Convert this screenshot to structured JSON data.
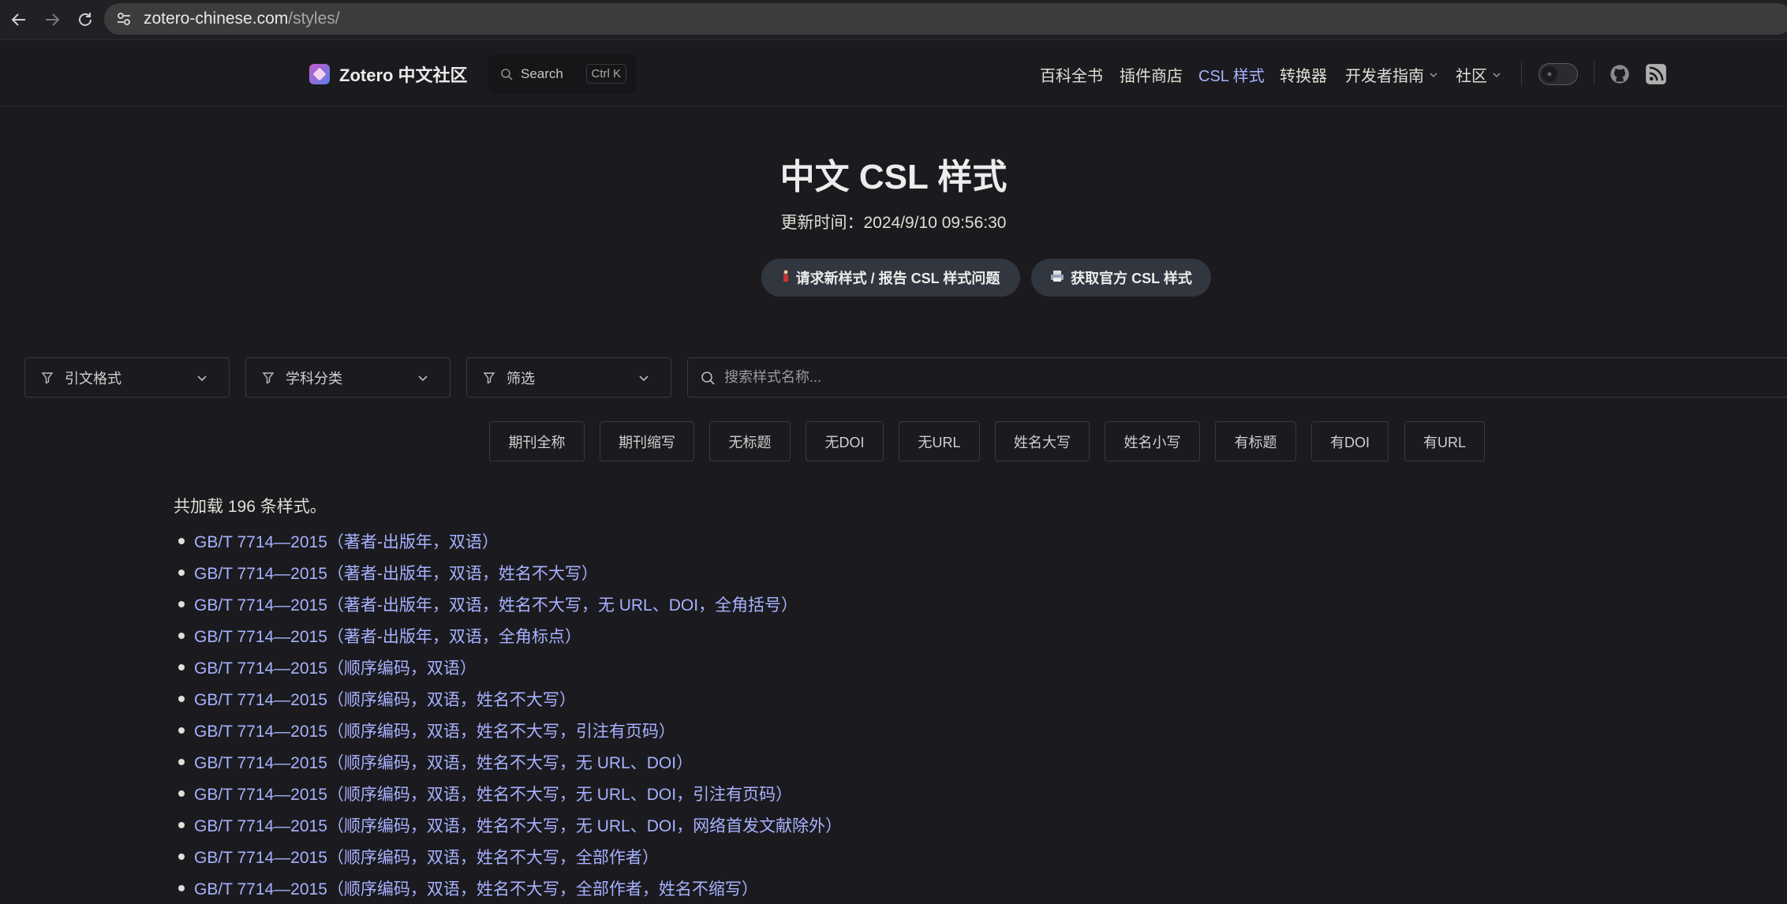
{
  "browser": {
    "url_domain": "zotero-chinese.com",
    "url_path": "/styles/"
  },
  "header": {
    "logo_text": "Zotero 中文社区",
    "search_label": "Search",
    "search_shortcut": "Ctrl K",
    "nav": [
      "百科全书",
      "插件商店",
      "CSL 样式",
      "转换器",
      "开发者指南",
      "社区"
    ],
    "active_nav": "CSL 样式"
  },
  "hero": {
    "title": "中文 CSL 样式",
    "updated": "更新时间：2024/9/10 09:56:30",
    "request_button": "请求新样式 / 报告 CSL 样式问题",
    "official_button": "获取官方 CSL 样式"
  },
  "filters": {
    "citation_format": "引文格式",
    "subject": "学科分类",
    "filter": "筛选",
    "search_placeholder": "搜索样式名称..."
  },
  "tags": [
    "期刊全称",
    "期刊缩写",
    "无标题",
    "无DOI",
    "无URL",
    "姓名大写",
    "姓名小写",
    "有标题",
    "有DOI",
    "有URL"
  ],
  "list": {
    "count_text": "共加载 196 条样式。",
    "items": [
      "GB/T 7714—2015（著者-出版年，双语）",
      "GB/T 7714—2015（著者-出版年，双语，姓名不大写）",
      "GB/T 7714—2015（著者-出版年，双语，姓名不大写，无 URL、DOI，全角括号）",
      "GB/T 7714—2015（著者-出版年，双语，全角标点）",
      "GB/T 7714—2015（顺序编码，双语）",
      "GB/T 7714—2015（顺序编码，双语，姓名不大写）",
      "GB/T 7714—2015（顺序编码，双语，姓名不大写，引注有页码）",
      "GB/T 7714—2015（顺序编码，双语，姓名不大写，无 URL、DOI）",
      "GB/T 7714—2015（顺序编码，双语，姓名不大写，无 URL、DOI，引注有页码）",
      "GB/T 7714—2015（顺序编码，双语，姓名不大写，无 URL、DOI，网络首发文献除外）",
      "GB/T 7714—2015（顺序编码，双语，姓名不大写，全部作者）",
      "GB/T 7714—2015（顺序编码，双语，姓名不大写，全部作者，姓名不缩写）"
    ]
  },
  "colors": {
    "background": "#1b1b1f",
    "link": "#a8b1ff",
    "text": "#dfdfd6"
  }
}
